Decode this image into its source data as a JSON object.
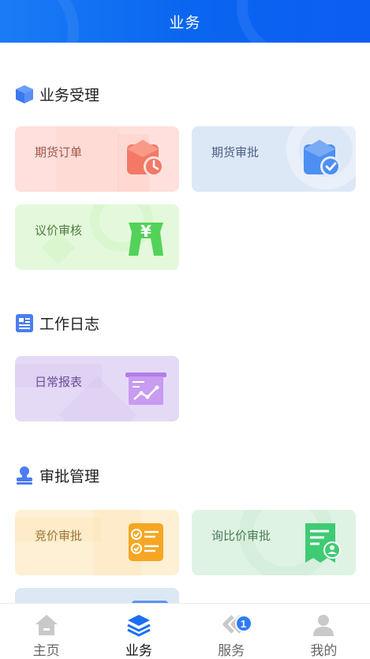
{
  "header": {
    "title": "业务"
  },
  "sections": [
    {
      "title": "业务受理",
      "icon": "cube-icon",
      "cards": [
        {
          "label": "期货订单",
          "icon": "clock-box-icon"
        },
        {
          "label": "期货审批",
          "icon": "check-box-icon"
        },
        {
          "label": "议价审核",
          "icon": "yuan-tag-icon"
        }
      ]
    },
    {
      "title": "工作日志",
      "icon": "document-icon",
      "cards": [
        {
          "label": "日常报表",
          "icon": "chart-board-icon"
        }
      ]
    },
    {
      "title": "审批管理",
      "icon": "stamp-icon",
      "cards": [
        {
          "label": "竞价审批",
          "icon": "checklist-icon"
        },
        {
          "label": "询比价审批",
          "icon": "certificate-icon"
        }
      ]
    }
  ],
  "tabbar": {
    "items": [
      {
        "label": "主页",
        "icon": "home-icon"
      },
      {
        "label": "业务",
        "icon": "layers-icon",
        "active": true
      },
      {
        "label": "服务",
        "icon": "chevrons-icon",
        "badge": "1"
      },
      {
        "label": "我的",
        "icon": "user-icon"
      }
    ]
  },
  "colors": {
    "accent": "#1a6ff5",
    "badge": "#2f7cf6"
  }
}
